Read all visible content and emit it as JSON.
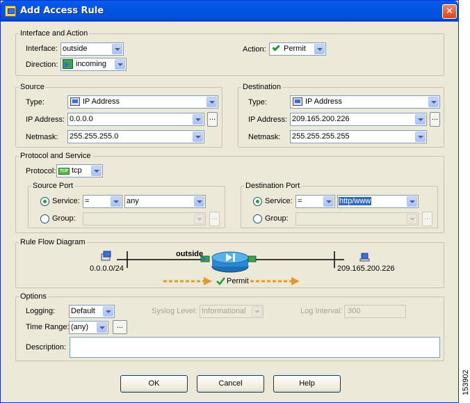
{
  "window": {
    "title": "Add Access Rule",
    "close_glyph": "✕"
  },
  "interface_action": {
    "legend": "Interface and Action",
    "interface_label": "Interface:",
    "interface_value": "outside",
    "direction_label": "Direction:",
    "direction_value": "incoming",
    "action_label": "Action:",
    "action_value": "Permit"
  },
  "source": {
    "legend": "Source",
    "type_label": "Type:",
    "type_value": "IP Address",
    "ip_label": "IP Address:",
    "ip_value": "0.0.0.0",
    "netmask_label": "Netmask:",
    "netmask_value": "255.255.255.0",
    "browse_label": "..."
  },
  "destination": {
    "legend": "Destination",
    "type_label": "Type:",
    "type_value": "IP Address",
    "ip_label": "IP Address:",
    "ip_value": "209.165.200.226",
    "netmask_label": "Netmask:",
    "netmask_value": "255.255.255.255",
    "browse_label": "..."
  },
  "protocol_service": {
    "legend": "Protocol and Service",
    "protocol_label": "Protocol:",
    "protocol_value": "tcp",
    "protocol_icon_text": "TCP",
    "source_port": {
      "legend": "Source Port",
      "service_label": "Service:",
      "operator_value": "=",
      "service_value": "any",
      "group_label": "Group:",
      "group_value": "",
      "browse_label": "..."
    },
    "destination_port": {
      "legend": "Destination Port",
      "service_label": "Service:",
      "operator_value": "=",
      "service_value": "http/www",
      "group_label": "Group:",
      "group_value": "",
      "browse_label": "..."
    }
  },
  "rule_flow": {
    "legend": "Rule Flow Diagram",
    "interface_label": "outside",
    "source_label": "0.0.0.0/24",
    "destination_label": "209.165.200.226",
    "action_label": "Permit"
  },
  "options": {
    "legend": "Options",
    "logging_label": "Logging:",
    "logging_value": "Default",
    "syslog_label": "Syslog Level:",
    "syslog_value": "Informational",
    "interval_label": "Log Interval:",
    "interval_value": "300",
    "time_range_label": "Time Range:",
    "time_range_value": "(any)",
    "time_range_browse": "...",
    "description_label": "Description:",
    "description_value": ""
  },
  "buttons": {
    "ok": "OK",
    "cancel": "Cancel",
    "help": "Help"
  },
  "side_id": "153902",
  "colors": {
    "titlebar": "#0151d9",
    "dialog_bg": "#ece9d8",
    "accent": "#2c7cd6"
  }
}
